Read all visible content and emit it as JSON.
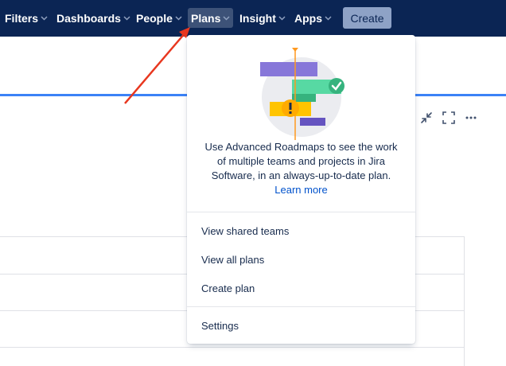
{
  "nav": {
    "items": [
      {
        "label": "Filters"
      },
      {
        "label": "Dashboards"
      },
      {
        "label": "People"
      },
      {
        "label": "Plans",
        "active": true
      },
      {
        "label": "Insight"
      },
      {
        "label": "Apps"
      }
    ],
    "create_label": "Create"
  },
  "plans_menu": {
    "promo": {
      "text": "Use Advanced Roadmaps to see the work of multiple teams and projects in Jira Software, in an always-up-to-date plan.",
      "link_label": "Learn more"
    },
    "items": [
      {
        "label": "View shared teams"
      },
      {
        "label": "View all plans"
      },
      {
        "label": "Create plan"
      }
    ],
    "settings_label": "Settings"
  },
  "colors": {
    "topbar": "#0b2554",
    "active_tab": "#3d5278",
    "create_button": "#8ea2c6",
    "link": "#0052cc",
    "annotation_arrow": "#e8371f"
  },
  "icons": [
    "chevron-down-icon",
    "minimize-icon",
    "fullscreen-icon",
    "more-icon",
    "check-icon",
    "warning-icon"
  ]
}
